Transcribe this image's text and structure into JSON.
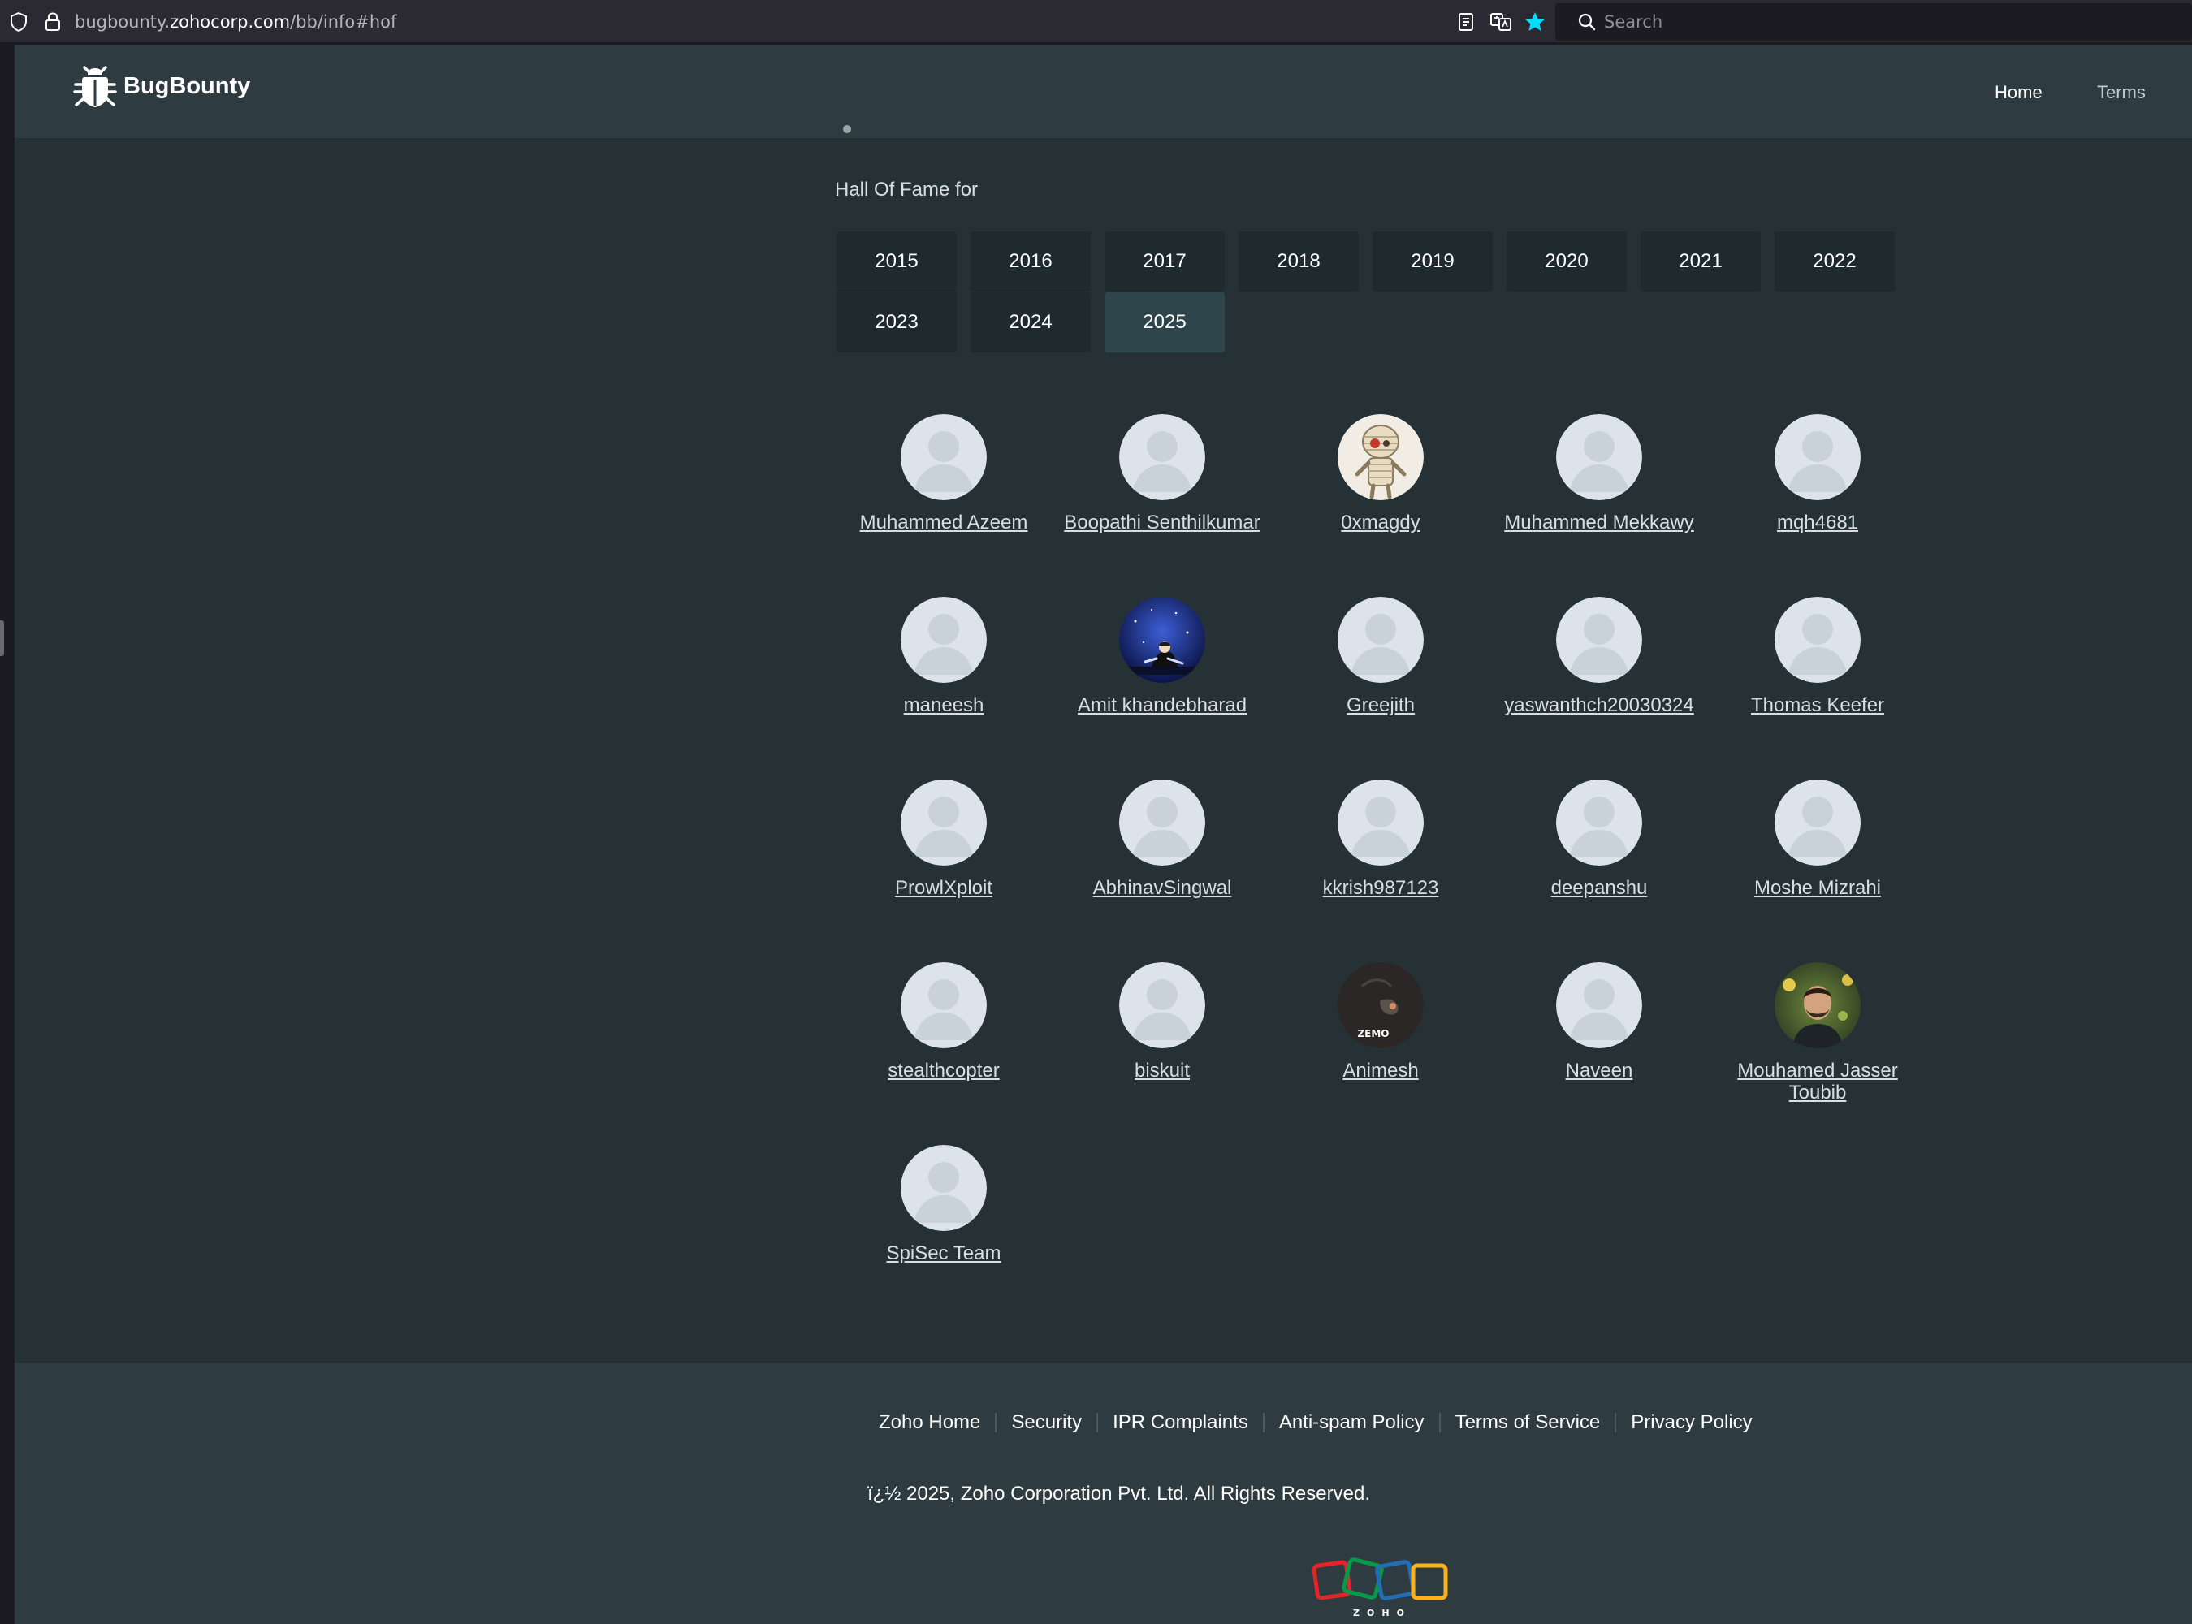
{
  "browser": {
    "url_prefix": "bugbounty.",
    "url_domain": "zohocorp.com",
    "url_path": "/bb/info#hof",
    "search_placeholder": "Search",
    "star_color": "#0df"
  },
  "header": {
    "brand": "BugBounty",
    "nav": {
      "home": "Home",
      "terms": "Terms"
    }
  },
  "hof": {
    "title": "Hall Of Fame for",
    "years": [
      "2015",
      "2016",
      "2017",
      "2018",
      "2019",
      "2020",
      "2021",
      "2022",
      "2023",
      "2024",
      "2025"
    ],
    "selected_year": "2025",
    "members": [
      {
        "name": "Muhammed Azeem",
        "avatar": "default-avatar"
      },
      {
        "name": "Boopathi Senthilkumar",
        "avatar": "default-avatar"
      },
      {
        "name": "0xmagdy",
        "avatar": "mummy-cartoon-avatar"
      },
      {
        "name": "Muhammed Mekkawy",
        "avatar": "default-avatar"
      },
      {
        "name": "mqh4681",
        "avatar": "default-avatar"
      },
      {
        "name": "maneesh",
        "avatar": "default-avatar"
      },
      {
        "name": "Amit khandebharad",
        "avatar": "night-sky-avatar"
      },
      {
        "name": "Greejith",
        "avatar": "default-avatar"
      },
      {
        "name": "yaswanthch20030324",
        "avatar": "default-avatar"
      },
      {
        "name": "Thomas Keefer",
        "avatar": "default-avatar"
      },
      {
        "name": "ProwlXploit",
        "avatar": "default-avatar"
      },
      {
        "name": "AbhinavSingwal",
        "avatar": "default-avatar"
      },
      {
        "name": "kkrish987123",
        "avatar": "default-avatar"
      },
      {
        "name": "deepanshu",
        "avatar": "default-avatar"
      },
      {
        "name": "Moshe Mizrahi",
        "avatar": "default-avatar"
      },
      {
        "name": "stealthcopter",
        "avatar": "default-avatar"
      },
      {
        "name": "biskuit",
        "avatar": "default-avatar"
      },
      {
        "name": "Animesh",
        "avatar": "zemo-dark-avatar",
        "avatar_text": "ZEMO"
      },
      {
        "name": "Naveen",
        "avatar": "default-avatar"
      },
      {
        "name": "Mouhamed Jasser Toubib",
        "avatar": "photo-avatar"
      },
      {
        "name": "SpiSec Team",
        "avatar": "default-avatar"
      }
    ]
  },
  "footer": {
    "links": [
      "Zoho Home",
      "Security",
      "IPR Complaints",
      "Anti-spam Policy",
      "Terms of Service",
      "Privacy Policy"
    ],
    "copyright": "ï¿½ 2025, Zoho Corporation Pvt. Ltd. All Rights Reserved.",
    "logo_text": "ZOHO",
    "logo_colors": [
      "#e42527",
      "#089949",
      "#226db4",
      "#f9b21d"
    ]
  }
}
